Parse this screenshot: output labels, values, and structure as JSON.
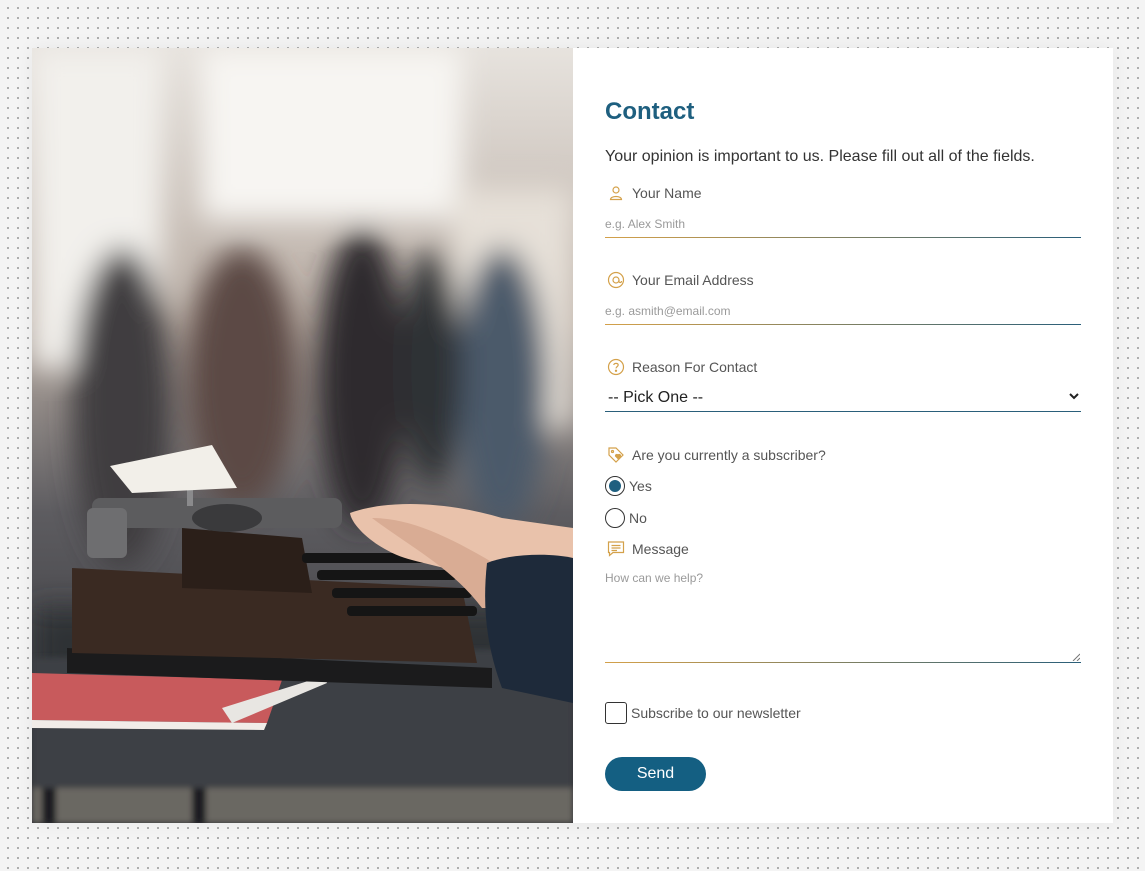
{
  "contact": {
    "title": "Contact",
    "intro": "Your opinion is important to us. Please fill out all of the fields."
  },
  "fields": {
    "name": {
      "label": "Your Name",
      "placeholder": "e.g. Alex Smith",
      "icon": "user-icon"
    },
    "email": {
      "label": "Your Email Address",
      "placeholder": "e.g. asmith@email.com",
      "icon": "at-icon"
    },
    "reason": {
      "label": "Reason For Contact",
      "selected": "-- Pick One --",
      "icon": "question-icon"
    },
    "subscriber": {
      "label": "Are you currently a subscriber?",
      "icon": "tag-icon",
      "options": [
        {
          "label": "Yes",
          "checked": true
        },
        {
          "label": "No",
          "checked": false
        }
      ]
    },
    "message": {
      "label": "Message",
      "placeholder": "How can we help?",
      "icon": "chat-icon"
    },
    "newsletter": {
      "label": "Subscribe to our newsletter",
      "checked": false
    }
  },
  "send": {
    "label": "Send"
  },
  "colors": {
    "accent": "#1e5f7f",
    "button": "#145f82",
    "icon": "#d4a14a",
    "text": "#555555"
  }
}
